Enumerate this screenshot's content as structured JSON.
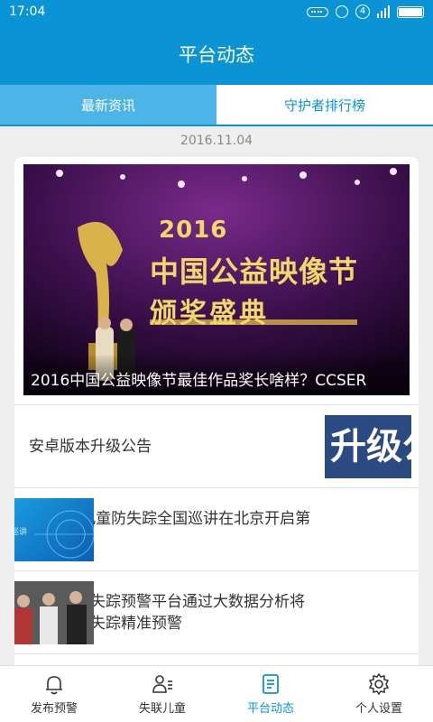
{
  "status_bar": {
    "time": "17:04",
    "notification_count": "4"
  },
  "header": {
    "title": "平台动态"
  },
  "tabs": [
    {
      "label": "最新资讯",
      "active": true
    },
    {
      "label": "守护者排行榜",
      "active": false
    }
  ],
  "feed": {
    "date": "2016.11.04",
    "hero": {
      "caption": "2016中国公益映像节最佳作品奖长啥样？CCSER",
      "image_text": {
        "year": "2016",
        "line1": "中国公益映像节",
        "line2": "颁奖盛典"
      }
    },
    "items": [
      {
        "title": "安卓版本升级公告",
        "thumb_text": "升级公"
      },
      {
        "title": "CCSER儿童防失踪全国巡讲在北京开启第一站",
        "thumb_text": "巡讲"
      },
      {
        "title": "中国儿童失踪预警平台通过大数据分析将实现儿童失踪精准预警"
      }
    ]
  },
  "bottom_nav": [
    {
      "label": "发布预警",
      "icon": "bell-icon",
      "active": false
    },
    {
      "label": "失联儿童",
      "icon": "child-list-icon",
      "active": false
    },
    {
      "label": "平台动态",
      "icon": "document-icon",
      "active": true
    },
    {
      "label": "个人设置",
      "icon": "gear-icon",
      "active": false
    }
  ],
  "colors": {
    "primary": "#0a94d6",
    "tab_active": "#4db4e8",
    "background": "#eeeeee"
  }
}
